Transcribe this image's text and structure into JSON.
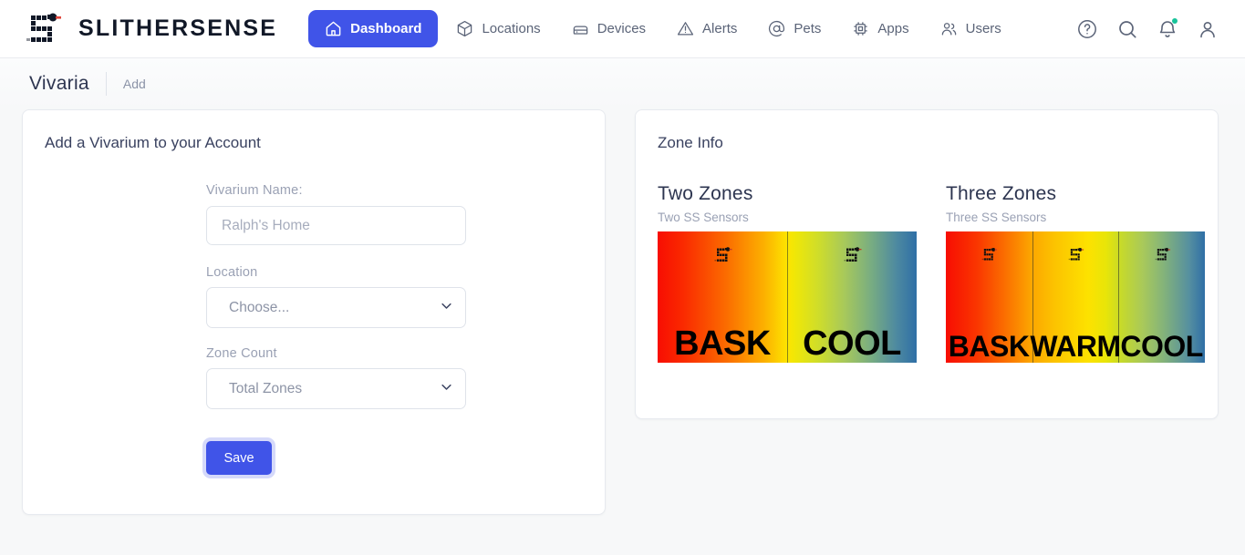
{
  "header": {
    "brand": "SLITHERSENSE",
    "logo_icon": "snake-logo-icon",
    "nav": [
      {
        "label": "Dashboard",
        "icon": "home-icon",
        "active": true
      },
      {
        "label": "Locations",
        "icon": "cube-icon",
        "active": false
      },
      {
        "label": "Devices",
        "icon": "device-icon",
        "active": false
      },
      {
        "label": "Alerts",
        "icon": "warning-triangle-icon",
        "active": false
      },
      {
        "label": "Pets",
        "icon": "at-sign-icon",
        "active": false
      },
      {
        "label": "Apps",
        "icon": "chip-icon",
        "active": false
      },
      {
        "label": "Users",
        "icon": "users-icon",
        "active": false
      }
    ],
    "actions": [
      {
        "name": "help-icon"
      },
      {
        "name": "search-icon"
      },
      {
        "name": "bell-icon",
        "badge": true
      },
      {
        "name": "account-icon"
      }
    ],
    "badge_color": "#18c39a",
    "accent_color": "#4054e8"
  },
  "breadcrumb": {
    "title": "Vivaria",
    "current": "Add"
  },
  "form_card": {
    "title": "Add a Vivarium to your Account",
    "name_label": "Vivarium Name:",
    "name_placeholder": "Ralph's Home",
    "name_value": "",
    "location_label": "Location",
    "location_selected": "Choose...",
    "location_options": [
      "Choose..."
    ],
    "zone_count_label": "Zone Count",
    "zone_count_selected": "Total Zones",
    "zone_count_options": [
      "Total Zones"
    ],
    "save_label": "Save"
  },
  "zone_info": {
    "title": "Zone Info",
    "blocks": [
      {
        "heading": "Two Zones",
        "subtitle": "Two SS Sensors",
        "zones": [
          "BASK",
          "COOL"
        ]
      },
      {
        "heading": "Three Zones",
        "subtitle": "Three SS Sensors",
        "zones": [
          "BASK",
          "WARM",
          "COOL"
        ]
      }
    ]
  }
}
